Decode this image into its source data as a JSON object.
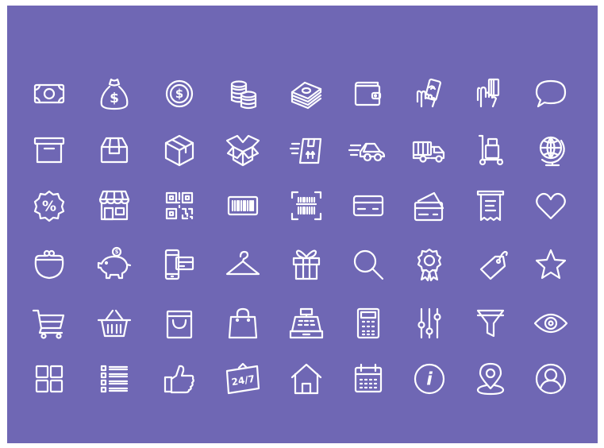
{
  "colors": {
    "background": "#6f67b4",
    "icon_stroke": "#ffffff"
  },
  "icons": [
    [
      {
        "name": "banknote-icon"
      },
      {
        "name": "money-bag-icon",
        "text": "$"
      },
      {
        "name": "coin-icon",
        "text": "$"
      },
      {
        "name": "coin-stacks-icon"
      },
      {
        "name": "cash-stack-icon"
      },
      {
        "name": "wallet-icon"
      },
      {
        "name": "hand-payment-icon"
      },
      {
        "name": "hand-card-icon"
      },
      {
        "name": "speech-bubble-icon"
      }
    ],
    [
      {
        "name": "archive-box-icon"
      },
      {
        "name": "package-icon"
      },
      {
        "name": "cube-box-icon"
      },
      {
        "name": "open-box-icon"
      },
      {
        "name": "fast-delivery-box-icon"
      },
      {
        "name": "delivery-car-icon"
      },
      {
        "name": "delivery-truck-icon"
      },
      {
        "name": "hand-truck-icon"
      },
      {
        "name": "globe-icon"
      }
    ],
    [
      {
        "name": "discount-badge-icon",
        "text": "%"
      },
      {
        "name": "storefront-icon"
      },
      {
        "name": "qr-code-icon"
      },
      {
        "name": "barcode-icon"
      },
      {
        "name": "barcode-scan-icon"
      },
      {
        "name": "credit-card-icon"
      },
      {
        "name": "cards-icon"
      },
      {
        "name": "receipt-icon"
      },
      {
        "name": "heart-icon"
      }
    ],
    [
      {
        "name": "coin-purse-icon"
      },
      {
        "name": "piggy-bank-icon",
        "text": "$"
      },
      {
        "name": "mobile-payment-icon"
      },
      {
        "name": "hanger-icon"
      },
      {
        "name": "gift-icon"
      },
      {
        "name": "magnifier-icon"
      },
      {
        "name": "award-ribbon-icon"
      },
      {
        "name": "price-tag-icon"
      },
      {
        "name": "star-icon"
      }
    ],
    [
      {
        "name": "shopping-cart-icon"
      },
      {
        "name": "shopping-basket-icon"
      },
      {
        "name": "shopping-bag-icon"
      },
      {
        "name": "tote-bag-icon"
      },
      {
        "name": "cash-register-icon"
      },
      {
        "name": "calculator-icon"
      },
      {
        "name": "sliders-icon"
      },
      {
        "name": "filter-funnel-icon"
      },
      {
        "name": "eye-icon"
      }
    ],
    [
      {
        "name": "grid-view-icon"
      },
      {
        "name": "list-view-icon"
      },
      {
        "name": "thumbs-up-icon"
      },
      {
        "name": "open-24-7-sign-icon",
        "text": "24/7"
      },
      {
        "name": "home-icon"
      },
      {
        "name": "calendar-icon"
      },
      {
        "name": "info-icon",
        "text": "i"
      },
      {
        "name": "location-pin-icon"
      },
      {
        "name": "user-profile-icon"
      }
    ]
  ]
}
